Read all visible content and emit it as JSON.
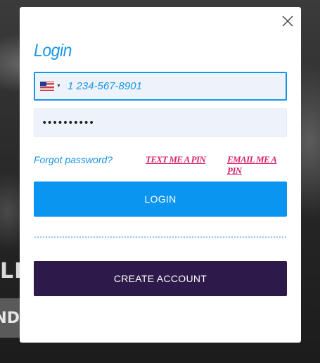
{
  "background": {
    "partial_text_1": "LD",
    "partial_text_2": "ND"
  },
  "modal": {
    "title": "Login",
    "close_icon": "close-icon",
    "phone": {
      "country_flag": "us-flag-icon",
      "placeholder": "1 234-567-8901",
      "value": ""
    },
    "password": {
      "value": "••••••••••"
    },
    "forgot_label": "Forgot password?",
    "text_pin_label": "TEXT ME A PIN",
    "email_pin_label": "EMAIL ME A PIN",
    "login_label": "LOGIN",
    "create_account_label": "CREATE ACCOUNT"
  },
  "colors": {
    "accent_blue": "#1696e8",
    "login_button": "#0a95f0",
    "pin_links": "#d6256e",
    "create_button": "#2d1a4a",
    "input_background": "#eef3fb"
  }
}
